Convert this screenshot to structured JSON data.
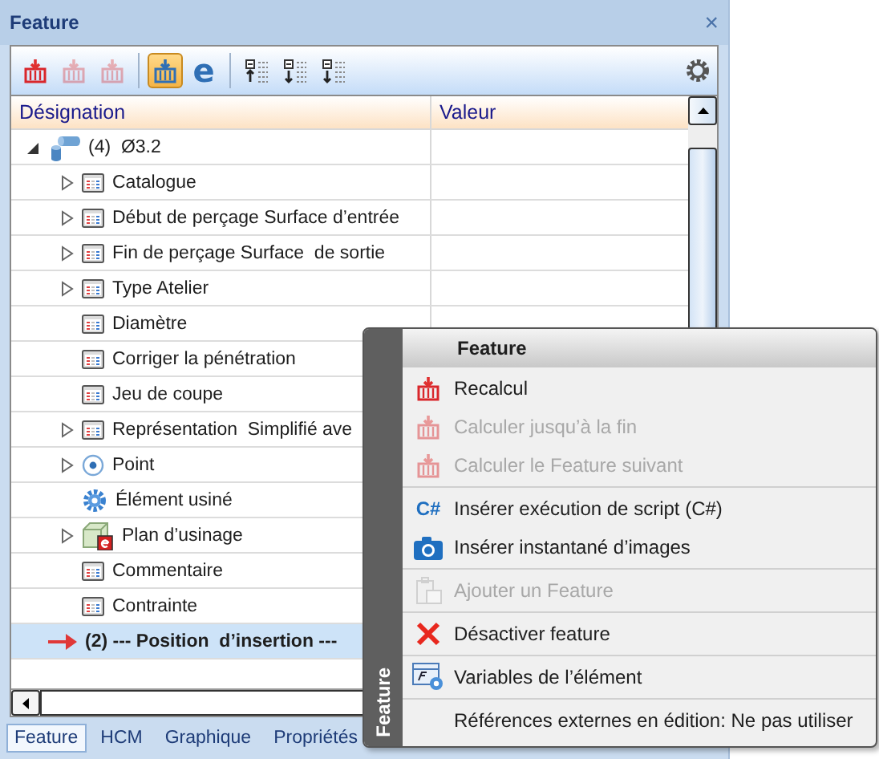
{
  "panel": {
    "title": "Feature",
    "close": "×"
  },
  "toolbar": [
    [
      {
        "kind": "recalc",
        "disabled": false,
        "selected": false
      },
      {
        "kind": "calc-end",
        "disabled": true,
        "selected": false
      },
      {
        "kind": "calc-next",
        "disabled": true,
        "selected": false
      }
    ],
    [
      {
        "kind": "recalc-blue",
        "disabled": false,
        "selected": true
      },
      {
        "kind": "text",
        "label": "e",
        "disabled": false,
        "selected": false
      }
    ],
    [
      {
        "kind": "tree-up",
        "disabled": false,
        "selected": false
      },
      {
        "kind": "tree-num",
        "disabled": false,
        "selected": false
      },
      {
        "kind": "tree-down",
        "disabled": false,
        "selected": false
      }
    ]
  ],
  "columns": [
    "Désignation",
    "Valeur"
  ],
  "tree": [
    {
      "label": "(4)  Ø3.2",
      "kind": "part",
      "expanded": true,
      "selected": false,
      "children": [
        {
          "label": "Catalogue",
          "kind": "table",
          "expanded": false,
          "selected": false
        },
        {
          "label": "Début de perçage Surface d’entrée",
          "kind": "table",
          "expanded": false,
          "selected": false
        },
        {
          "label": "Fin de perçage Surface  de sortie",
          "kind": "table",
          "expanded": false,
          "selected": false
        },
        {
          "label": "Type Atelier",
          "kind": "table",
          "expanded": false,
          "selected": false
        },
        {
          "label": "Diamètre",
          "kind": "table",
          "selected": false
        },
        {
          "label": "Corriger la pénétration",
          "kind": "table",
          "selected": false
        },
        {
          "label": "Jeu de coupe",
          "kind": "table",
          "selected": false
        },
        {
          "label": "Représentation  Simplifié ave",
          "kind": "table",
          "expanded": false,
          "selected": false
        },
        {
          "label": "Point",
          "kind": "point",
          "expanded": false,
          "selected": false
        },
        {
          "label": "Élément usiné",
          "kind": "gear",
          "selected": false
        },
        {
          "label": "Plan d’usinage",
          "kind": "plane",
          "expanded": false,
          "selected": false
        },
        {
          "label": "Commentaire",
          "kind": "table",
          "selected": false
        },
        {
          "label": "Contrainte",
          "kind": "table",
          "selected": false
        }
      ]
    },
    {
      "label": "(2) --- Position  d’insertion ---",
      "kind": "arrow",
      "selected": true
    }
  ],
  "tabs": [
    {
      "label": "Feature",
      "selected": true
    },
    {
      "label": "HCM",
      "selected": false
    },
    {
      "label": "Graphique",
      "selected": false
    },
    {
      "label": "Propriétés",
      "selected": false
    }
  ],
  "context_menu": {
    "side_label": "Feature",
    "header": "Feature",
    "groups": [
      [
        {
          "label": "Recalcul",
          "kind": "recalc",
          "disabled": false
        },
        {
          "label": "Calculer jusqu’à la fin",
          "kind": "calc-end",
          "disabled": true
        },
        {
          "label": "Calculer le Feature suivant",
          "kind": "calc-next",
          "disabled": true
        }
      ],
      [
        {
          "label": "Insérer exécution de script (C#)",
          "kind": "text",
          "icon_text": "C#",
          "disabled": false
        },
        {
          "label": "Insérer instantané d’images",
          "kind": "camera",
          "disabled": false
        }
      ],
      [
        {
          "label": "Ajouter un Feature",
          "kind": "clipboard",
          "disabled": true
        }
      ],
      [
        {
          "label": "Désactiver feature",
          "kind": "cross",
          "disabled": false
        }
      ],
      [
        {
          "label": "Variables de l’élément",
          "kind": "variables",
          "disabled": false
        }
      ],
      [
        {
          "label": "Références externes en édition: Ne pas utiliser",
          "kind": "plain",
          "disabled": false
        }
      ]
    ]
  }
}
